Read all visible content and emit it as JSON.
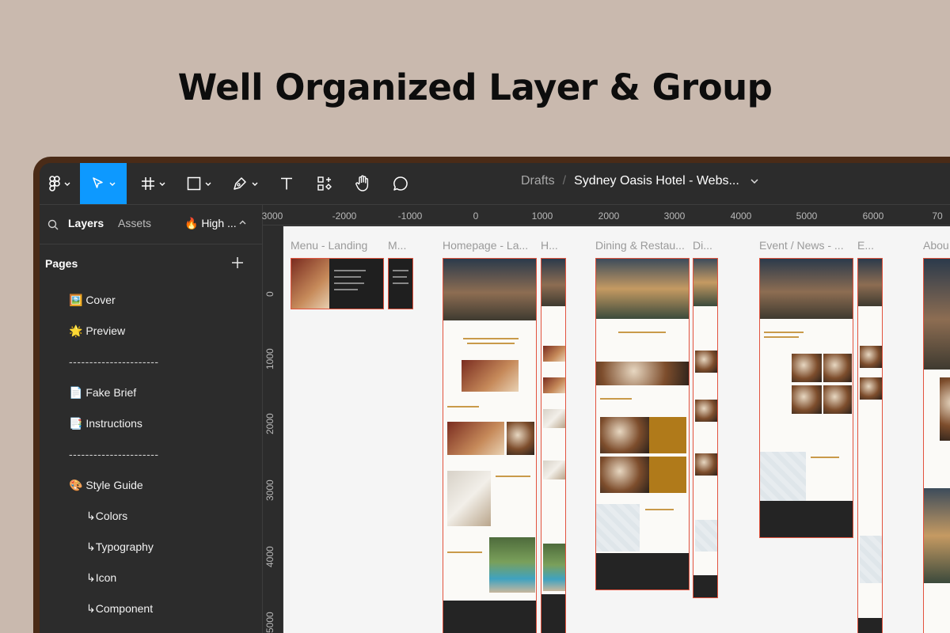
{
  "headline": "Well Organized Layer & Group",
  "toolbar": {
    "breadcrumb_parent": "Drafts",
    "breadcrumb_separator": "/",
    "file_name": "Sydney Oasis Hotel - Webs...",
    "accent": "#0d99ff"
  },
  "sidebar": {
    "tab_layers": "Layers",
    "tab_assets": "Assets",
    "page_selector": "🔥 High ...",
    "pages_heading": "Pages",
    "pages": [
      {
        "label": "🖼️ Cover"
      },
      {
        "label": "🌟 Preview"
      },
      {
        "label": "----------------------"
      },
      {
        "label": "📄 Fake Brief"
      },
      {
        "label": "📑 Instructions"
      },
      {
        "label": "----------------------"
      },
      {
        "label": "🎨 Style Guide"
      },
      {
        "label": "↳Colors"
      },
      {
        "label": "↳Typography"
      },
      {
        "label": "↳Icon"
      },
      {
        "label": "↳Component"
      }
    ]
  },
  "ruler": {
    "top": [
      "3000",
      "-2000",
      "-1000",
      "0",
      "1000",
      "2000",
      "3000",
      "4000",
      "5000",
      "6000",
      "70"
    ],
    "left": [
      "0",
      "1000",
      "2000",
      "3000",
      "4000",
      "5000"
    ]
  },
  "frames": {
    "menu_landing": "Menu - Landing",
    "menu_short": "M...",
    "homepage": "Homepage - La...",
    "homepage_short": "H...",
    "dining": "Dining & Restau...",
    "dining_short": "Di...",
    "event": "Event / News - ...",
    "event_short": "E...",
    "about": "Abou"
  }
}
